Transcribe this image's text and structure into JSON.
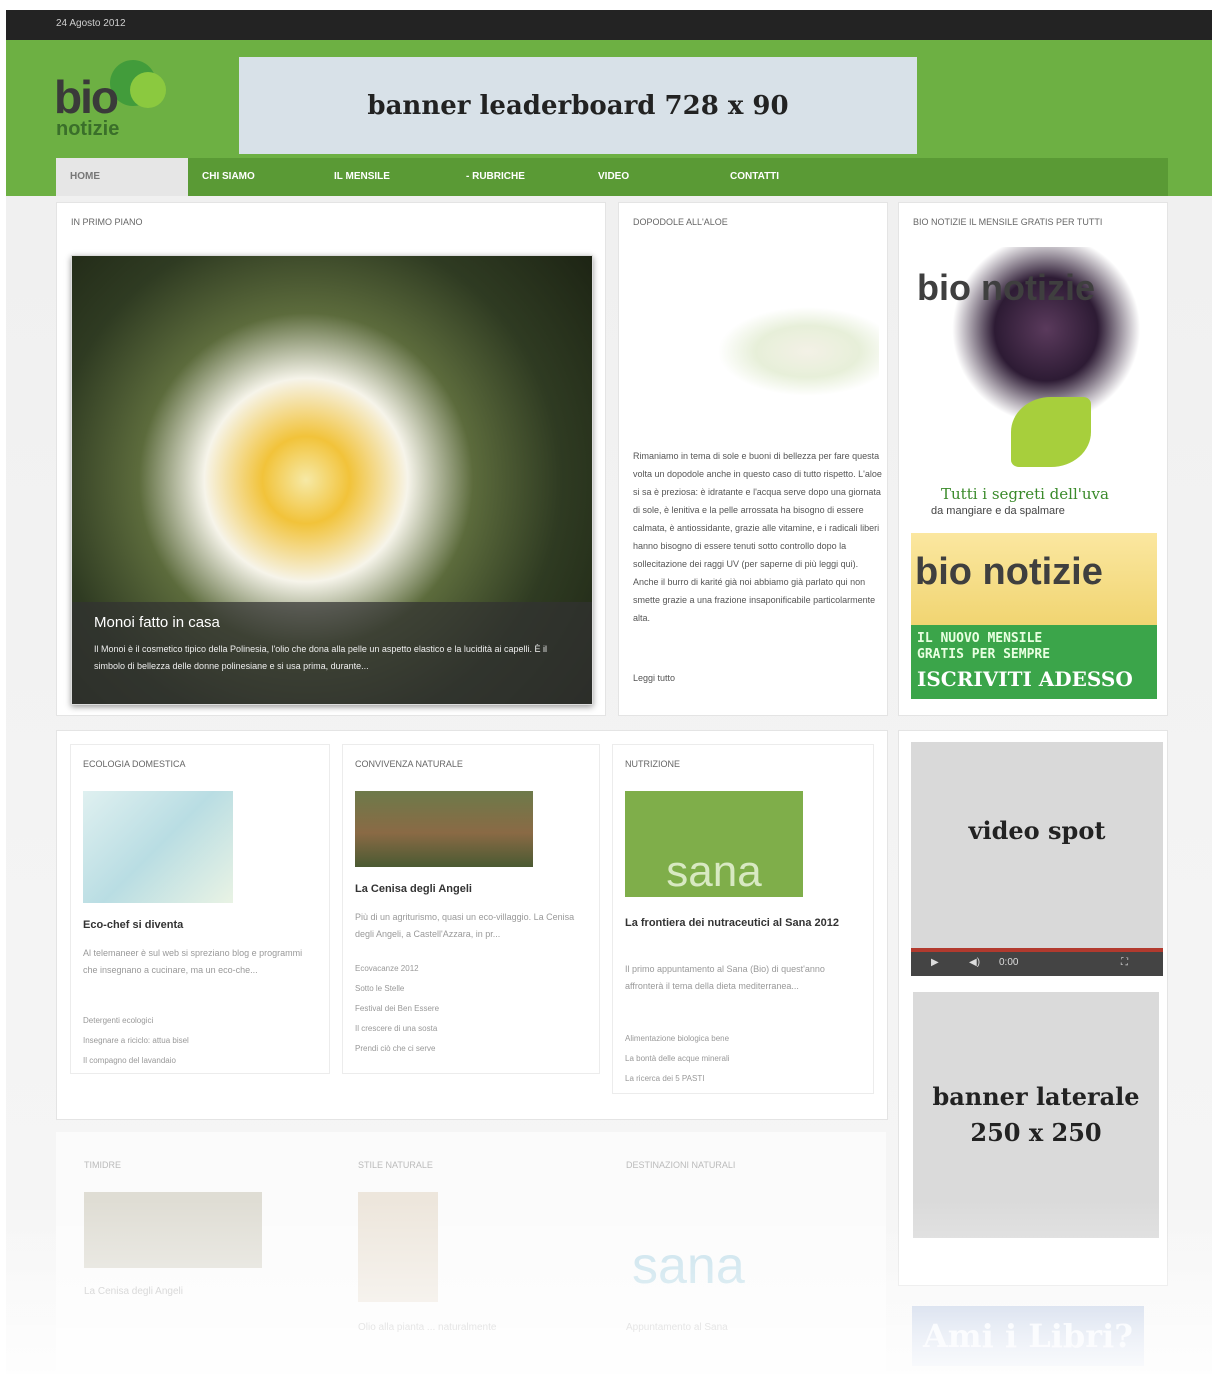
{
  "topbar": {
    "date": "24 Agosto 2012"
  },
  "header": {
    "logo_bio": "bio",
    "logo_notizie": "notizie",
    "leaderboard": "banner leaderboard 728 x 90"
  },
  "nav": {
    "items": [
      "HOME",
      "CHI SIAMO",
      "IL MENSILE",
      "- RUBRICHE",
      "VIDEO",
      "CONTATTI"
    ]
  },
  "primo_piano": {
    "title": "IN PRIMO PIANO",
    "caption_title": "Monoi fatto in casa",
    "caption_text": "Il Monoi è il cosmetico tipico della Polinesia, l'olio che dona alla pelle un aspetto elastico e la lucidità ai capelli. È il simbolo di bellezza delle donne polinesiane e si usa prima, durante..."
  },
  "dopodole": {
    "title": "DOPODOLE ALL'ALOE",
    "text": "Rimaniamo in tema di sole e buoni di bellezza per fare questa volta un dopodole anche in questo caso di tutto rispetto. L'aloe si sa è preziosa: è idratante e l'acqua serve dopo una giornata di sole, è lenitiva e la pelle arrossata ha bisogno di essere calmata, è antiossidante, grazie alle vitamine, e i radicali liberi hanno bisogno di essere tenuti sotto controllo dopo la sollecitazione dei raggi UV (per saperne di più leggi qui). Anche il burro di karité già noi abbiamo già parlato qui non smette grazie a una frazione insaponificabile particolarmente alta.",
    "more": "Leggi tutto"
  },
  "sidebar": {
    "title": "BIO NOTIZIE IL MENSILE GRATIS PER TUTTI",
    "grapes_brand": "bio notizie",
    "grapes_tagline": "Tutti i segreti dell'uva",
    "grapes_sub": "da mangiare e da spalmare",
    "promo_brand": "bio notizie",
    "promo_line1": "IL NUOVO MENSILE",
    "promo_line2": "GRATIS PER SEMPRE",
    "promo_cta": "ISCRIVITI ADESSO",
    "video_label": "video spot",
    "video_time": "0:00",
    "side_banner_line1": "banner laterale",
    "side_banner_line2": "250 x 250",
    "bottom_ad": "Ami i Libri?"
  },
  "categories": [
    {
      "title": "ECOLOGIA DOMESTICA",
      "headline": "Eco-chef si diventa",
      "excerpt": "Al telemaneer è sul web si spreziano blog e programmi che insegnano a cucinare, ma un eco-che...",
      "links": [
        "Detergenti ecologici",
        "Insegnare a riciclo: attua bisel",
        "Il compagno del lavandaio"
      ]
    },
    {
      "title": "CONVIVENZA NATURALE",
      "headline": "La Cenisa degli Angeli",
      "excerpt": "Più di un agriturismo, quasi un eco-villaggio. La Cenisa degli Angeli, a Castell'Azzara, in pr...",
      "links": [
        "Ecovacanze 2012",
        "Sotto le Stelle",
        "Festival dei Ben Essere",
        "Il crescere di una sosta",
        "Prendi ciò che ci serve"
      ]
    },
    {
      "title": "NUTRIZIONE",
      "headline": "La frontiera dei nutraceutici al Sana 2012",
      "excerpt": "Il primo appuntamento al Sana (Bio) di quest'anno affronterà il tema della dieta mediterranea...",
      "links": [
        "Alimentazione biologica bene",
        "La bontà delle acque minerali",
        "La ricerca dei 5 PASTI"
      ]
    }
  ],
  "faded": {
    "titles": [
      "TIMIDRE",
      "STILE NATURALE",
      "DESTINAZIONI NATURALI"
    ],
    "headlines": [
      "La Cenisa degli Angeli",
      "Olio alla pianta ... naturalmente",
      "Appuntamento al Sana"
    ],
    "sana": "sana"
  }
}
